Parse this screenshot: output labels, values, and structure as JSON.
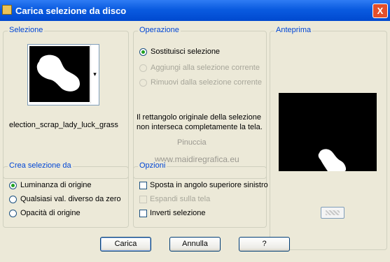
{
  "window": {
    "title": "Carica selezione da disco",
    "close_glyph": "X"
  },
  "selezione": {
    "legend": "Selezione",
    "filename": "election_scrap_lady_luck_grass",
    "dropdown_arrow": "▾"
  },
  "operazione": {
    "legend": "Operazione",
    "options": [
      {
        "label": "Sostituisci selezione",
        "checked": true,
        "enabled": true
      },
      {
        "label": "Aggiungi alla selezione corrente",
        "checked": false,
        "enabled": false
      },
      {
        "label": "Rimuovi dalla selezione corrente",
        "checked": false,
        "enabled": false
      }
    ],
    "info_line1": "Il rettangolo originale della selezione",
    "info_line2": "non interseca completamente la tela."
  },
  "anteprima": {
    "legend": "Anteprima"
  },
  "crea": {
    "legend": "Crea selezione da",
    "options": [
      {
        "label": "Luminanza di origine",
        "checked": true
      },
      {
        "label": "Qualsiasi val. diverso da zero",
        "checked": false
      },
      {
        "label": "Opacità di origine",
        "checked": false
      }
    ]
  },
  "opzioni": {
    "legend": "Opzioni",
    "items": [
      {
        "label": "Sposta in angolo superiore sinistro",
        "checked": false,
        "enabled": true
      },
      {
        "label": "Espandi sulla tela",
        "checked": false,
        "enabled": false
      },
      {
        "label": "Inverti selezione",
        "checked": false,
        "enabled": true
      }
    ]
  },
  "watermark": {
    "line1": "Pinuccia",
    "line2": "www.maidiregrafica.eu"
  },
  "buttons": {
    "load": "Carica",
    "cancel": "Annulla",
    "help": "?"
  },
  "colors": {
    "title_bar": "#0a5be0",
    "legend_text": "#0046d5",
    "dialog_bg": "#ece9d8",
    "disabled_text": "#a7a69a"
  }
}
